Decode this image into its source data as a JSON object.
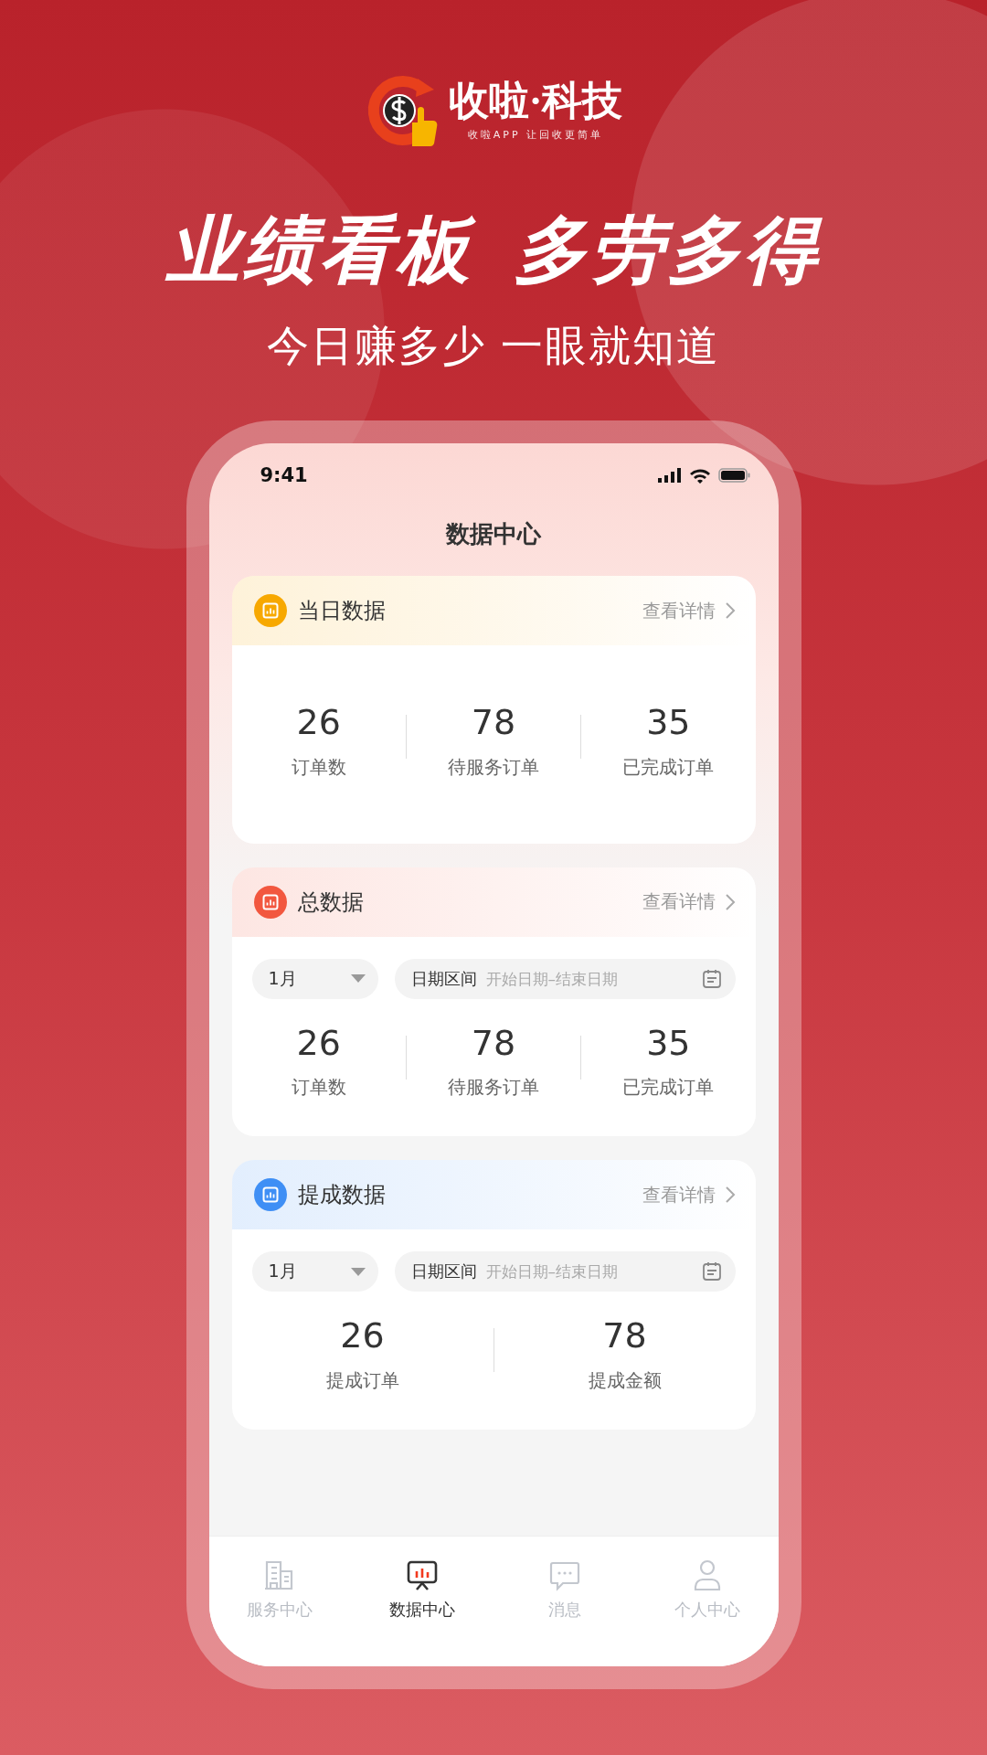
{
  "logo": {
    "name": "收啦·科技",
    "tagline": "收啦APP 让回收更简单"
  },
  "headline": [
    "业绩看板",
    "多劳多得"
  ],
  "subtitle": "今日赚多少 一眼就知道",
  "phone": {
    "status_bar": {
      "time": "9:41"
    },
    "title": "数据中心",
    "cards": [
      {
        "title": "当日数据",
        "color": "#f7a800",
        "link": "查看详情",
        "stats": [
          {
            "value": "26",
            "label": "订单数"
          },
          {
            "value": "78",
            "label": "待服务订单"
          },
          {
            "value": "35",
            "label": "已完成订单"
          }
        ]
      },
      {
        "title": "总数据",
        "color": "#f2573f",
        "link": "查看详情",
        "filters": {
          "month": "1月",
          "range_label": "日期区间",
          "placeholder": "开始日期–结束日期"
        },
        "stats": [
          {
            "value": "26",
            "label": "订单数"
          },
          {
            "value": "78",
            "label": "待服务订单"
          },
          {
            "value": "35",
            "label": "已完成订单"
          }
        ]
      },
      {
        "title": "提成数据",
        "color": "#3f8ff5",
        "link": "查看详情",
        "filters": {
          "month": "1月",
          "range_label": "日期区间",
          "placeholder": "开始日期–结束日期"
        },
        "stats": [
          {
            "value": "26",
            "label": "提成订单"
          },
          {
            "value": "78",
            "label": "提成金额"
          }
        ]
      }
    ],
    "tabs": [
      {
        "kind": "building",
        "label": "服务中心",
        "selected": false
      },
      {
        "kind": "board",
        "label": "数据中心",
        "selected": true
      },
      {
        "kind": "chat",
        "label": "消息",
        "selected": false
      },
      {
        "kind": "person",
        "label": "个人中心",
        "selected": false
      }
    ]
  }
}
